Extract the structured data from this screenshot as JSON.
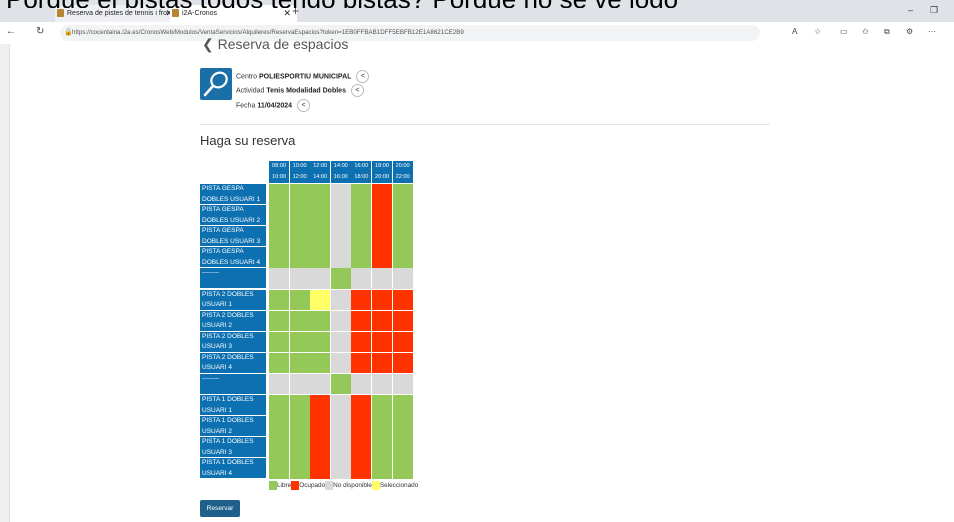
{
  "overlay_text": "Porque el pistas todos tengo pistas? Porque no se ve jogo",
  "browser": {
    "tabs": [
      {
        "label": "Reserva de pistes de tennis i front",
        "close": "✕"
      },
      {
        "label": "i2A-Cronos",
        "close": "✕"
      }
    ],
    "new_tab": "+",
    "url": "https://cocentaina.i2a.es/CronosWeb/Modulos/VentaServicios/Alquileres/ReservaEspacios?token=1EB0FFBAB1DFF5EBFB12E1A8621CE2B9",
    "window_controls": [
      "–",
      "❐"
    ]
  },
  "page": {
    "back_label": "Reserva de espacios",
    "centro_label": "Centro",
    "centro_value": "POLIESPORTIU MUNICIPAL",
    "actividad_label": "Actividad",
    "actividad_value": "Tenis Modalidad Dobles",
    "fecha_label": "Fecha",
    "fecha_value": "11/04/2024",
    "heading": "Haga su reserva",
    "time_slots": [
      {
        "start": "08:00",
        "end": "10:00"
      },
      {
        "start": "10:00",
        "end": "12:00"
      },
      {
        "start": "12:00",
        "end": "14:00"
      },
      {
        "start": "14:00",
        "end": "16:00"
      },
      {
        "start": "16:00",
        "end": "18:00"
      },
      {
        "start": "18:00",
        "end": "20:00"
      },
      {
        "start": "20:00",
        "end": "22:00"
      }
    ],
    "rows": [
      {
        "line1": "PISTA GESPA",
        "line2": "DOBLES USUARI 1",
        "status": [
          "libre",
          "libre",
          "libre",
          "no_disponible",
          "libre",
          "ocupado",
          "libre"
        ]
      },
      {
        "line1": "PISTA GESPA",
        "line2": "DOBLES USUARI 2",
        "status": [
          "libre",
          "libre",
          "libre",
          "no_disponible",
          "libre",
          "ocupado",
          "libre"
        ]
      },
      {
        "line1": "PISTA GESPA",
        "line2": "DOBLES USUARI 3",
        "status": [
          "libre",
          "libre",
          "libre",
          "no_disponible",
          "libre",
          "ocupado",
          "libre"
        ]
      },
      {
        "line1": "PISTA GESPA",
        "line2": "DOBLES USUARI 4",
        "status": [
          "libre",
          "libre",
          "libre",
          "no_disponible",
          "libre",
          "ocupado",
          "libre"
        ]
      },
      {
        "line1": "--------",
        "line2": "",
        "status": [
          "no_disponible",
          "no_disponible",
          "no_disponible",
          "libre",
          "no_disponible",
          "no_disponible",
          "no_disponible"
        ]
      },
      {
        "line1": "PISTA 2 DOBLES",
        "line2": "USUARI 1",
        "status": [
          "libre",
          "libre",
          "seleccionado",
          "no_disponible",
          "ocupado",
          "ocupado",
          "ocupado"
        ]
      },
      {
        "line1": "PISTA 2 DOBLES",
        "line2": "USUARI 2",
        "status": [
          "libre",
          "libre",
          "libre",
          "no_disponible",
          "ocupado",
          "ocupado",
          "ocupado"
        ]
      },
      {
        "line1": "PISTA 2 DOBLES",
        "line2": "USUARI 3",
        "status": [
          "libre",
          "libre",
          "libre",
          "no_disponible",
          "ocupado",
          "ocupado",
          "ocupado"
        ]
      },
      {
        "line1": "PISTA 2 DOBLES",
        "line2": "USUARI 4",
        "status": [
          "libre",
          "libre",
          "libre",
          "no_disponible",
          "ocupado",
          "ocupado",
          "ocupado"
        ]
      },
      {
        "line1": "--------",
        "line2": "",
        "status": [
          "no_disponible",
          "no_disponible",
          "no_disponible",
          "libre",
          "no_disponible",
          "no_disponible",
          "no_disponible"
        ]
      },
      {
        "line1": "PISTA 1 DOBLES",
        "line2": "USUARI 1",
        "status": [
          "libre",
          "libre",
          "ocupado",
          "no_disponible",
          "ocupado",
          "libre",
          "libre"
        ]
      },
      {
        "line1": "PISTA 1 DOBLES",
        "line2": "USUARI 2",
        "status": [
          "libre",
          "libre",
          "ocupado",
          "no_disponible",
          "ocupado",
          "libre",
          "libre"
        ]
      },
      {
        "line1": "PISTA 1 DOBLES",
        "line2": "USUARI 3",
        "status": [
          "libre",
          "libre",
          "ocupado",
          "no_disponible",
          "ocupado",
          "libre",
          "libre"
        ]
      },
      {
        "line1": "PISTA 1 DOBLES",
        "line2": "USUARI 4",
        "status": [
          "libre",
          "libre",
          "ocupado",
          "no_disponible",
          "ocupado",
          "libre",
          "libre"
        ]
      }
    ],
    "legend": {
      "libre": "Libre",
      "ocupado": "Ocupado",
      "no_disponible": "No disponible",
      "seleccionado": "Seleccionado"
    },
    "reservar_button": "Reservar"
  },
  "colors": {
    "libre": "#94c95a",
    "ocupado": "#ff3300",
    "no_disponible": "#d9d9d9",
    "seleccionado": "#ffff66",
    "header": "#0d70b0"
  }
}
